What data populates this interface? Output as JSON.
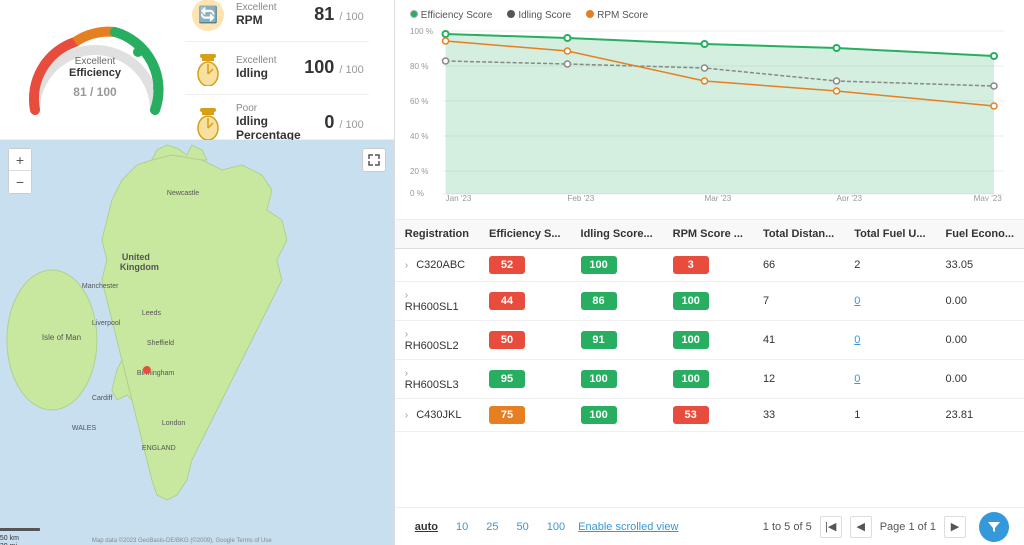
{
  "gauge": {
    "quality": "Excellent",
    "label": "Efficiency",
    "score": "81",
    "total": "100"
  },
  "metrics": [
    {
      "id": "rpm",
      "icon": "🔄",
      "quality": "Excellent",
      "name": "RPM",
      "score": "81",
      "total": "100"
    },
    {
      "id": "idling",
      "icon": "⏳",
      "quality": "Excellent",
      "name": "Idling",
      "score": "100",
      "total": "100"
    },
    {
      "id": "idling-pct",
      "icon": "⏳",
      "quality": "Poor",
      "name": "Idling Percentage",
      "score": "0",
      "total": "100"
    }
  ],
  "chart": {
    "legend": [
      {
        "label": "Efficiency Score",
        "color": "#27ae60",
        "type": "dot"
      },
      {
        "label": "Idling Score",
        "color": "#555",
        "type": "dot"
      },
      {
        "label": "RPM Score",
        "color": "#e67e22",
        "type": "dot"
      }
    ],
    "yAxis": [
      "100 %",
      "80 %",
      "60 %",
      "40 %",
      "20 %",
      "0 %"
    ],
    "xAxis": [
      "Jan '23",
      "Feb '23",
      "Mar '23",
      "Apr '23",
      "May '23"
    ]
  },
  "table": {
    "columns": [
      "Registration",
      "Efficiency S...",
      "Idling Score...",
      "RPM Score ...",
      "Total Distan...",
      "Total Fuel U...",
      "Fuel Econo..."
    ],
    "rows": [
      {
        "reg": "C320ABC",
        "eff": "52",
        "eff_color": "red",
        "idl": "100",
        "idl_color": "green",
        "rpm": "3",
        "rpm_color": "red",
        "dist": "66",
        "fuel": "2",
        "eco": "33.05"
      },
      {
        "reg": "RH600SL1",
        "eff": "44",
        "eff_color": "red",
        "idl": "86",
        "idl_color": "green",
        "rpm": "100",
        "rpm_color": "green",
        "dist": "7",
        "fuel": "0",
        "eco": "0.00"
      },
      {
        "reg": "RH600SL2",
        "eff": "50",
        "eff_color": "red",
        "idl": "91",
        "idl_color": "green",
        "rpm": "100",
        "rpm_color": "green",
        "dist": "41",
        "fuel": "0",
        "eco": "0.00"
      },
      {
        "reg": "RH600SL3",
        "eff": "95",
        "eff_color": "green",
        "idl": "100",
        "idl_color": "green",
        "rpm": "100",
        "rpm_color": "green",
        "dist": "12",
        "fuel": "0",
        "eco": "0.00"
      },
      {
        "reg": "C430JKL",
        "eff": "75",
        "eff_color": "orange",
        "idl": "100",
        "idl_color": "green",
        "rpm": "53",
        "rpm_color": "red",
        "dist": "33",
        "fuel": "1",
        "eco": "23.81"
      }
    ]
  },
  "pagination": {
    "sizes": [
      "auto",
      "10",
      "25",
      "50",
      "100"
    ],
    "scroll_label": "Enable scrolled view",
    "info": "1 to 5 of 5",
    "page_info": "Page 1 of 1"
  },
  "map": {
    "zoom_in": "+",
    "zoom_out": "−"
  }
}
